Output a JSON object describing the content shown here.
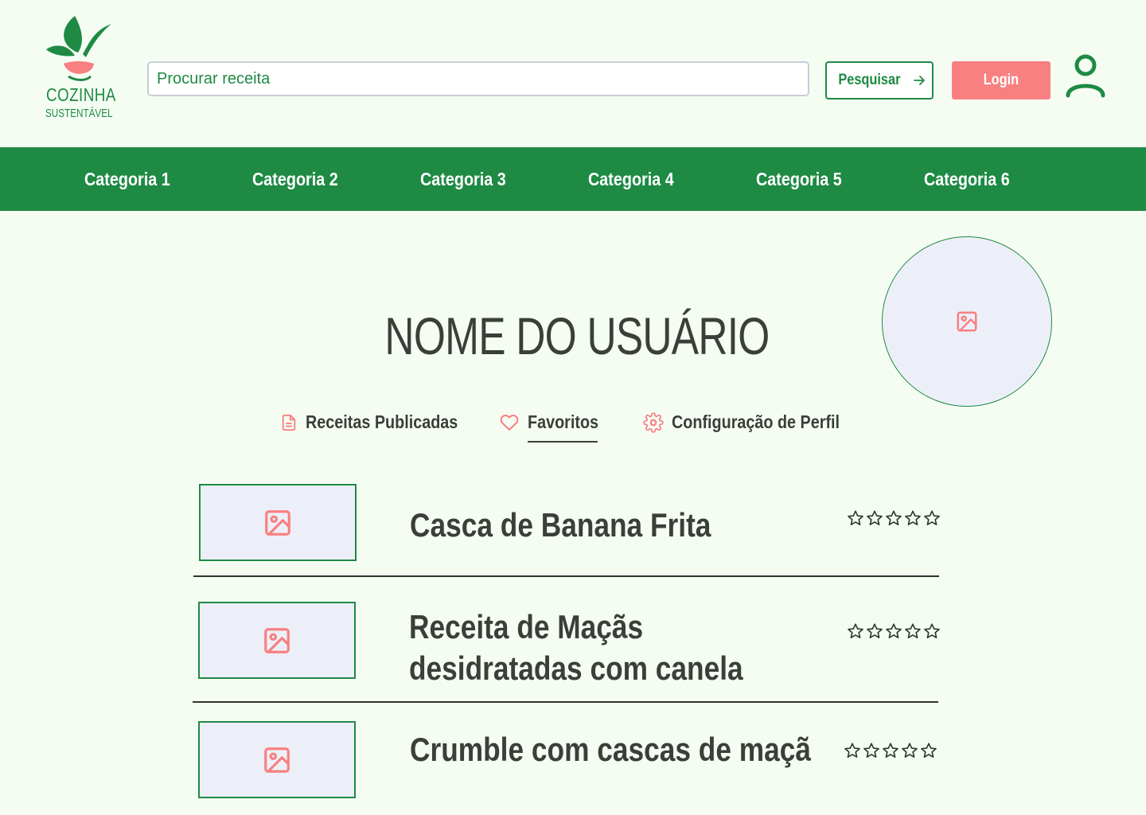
{
  "brand": {
    "line1": "COZINHA",
    "line2": "SUSTENTÁVEL",
    "primary_color": "#1e8a44",
    "accent_color": "#f88080"
  },
  "header": {
    "search_placeholder": "Procurar receita",
    "search_button": "Pesquisar",
    "search_button_icon": "arrow-right-icon",
    "login_button": "Login",
    "user_icon": "user-icon"
  },
  "nav": {
    "items": [
      "Categoria 1",
      "Categoria 2",
      "Categoria 3",
      "Categoria 4",
      "Categoria 5",
      "Categoria 6"
    ]
  },
  "profile": {
    "username": "NOME DO USUÁRIO",
    "avatar_icon": "image-placeholder-icon"
  },
  "tabs": [
    {
      "label": "Receitas Publicadas",
      "icon": "document-icon",
      "active": false
    },
    {
      "label": "Favoritos",
      "icon": "heart-icon",
      "active": true
    },
    {
      "label": "Configuração de Perfil",
      "icon": "gear-icon",
      "active": false
    }
  ],
  "recipes": [
    {
      "title": "Casca de Banana Frita",
      "rating": 0,
      "max_rating": 5
    },
    {
      "title": "Receita de Maçãs desidratadas com canela",
      "rating": 0,
      "max_rating": 5
    },
    {
      "title": "Crumble com cascas de maçã",
      "rating": 0,
      "max_rating": 5
    }
  ]
}
